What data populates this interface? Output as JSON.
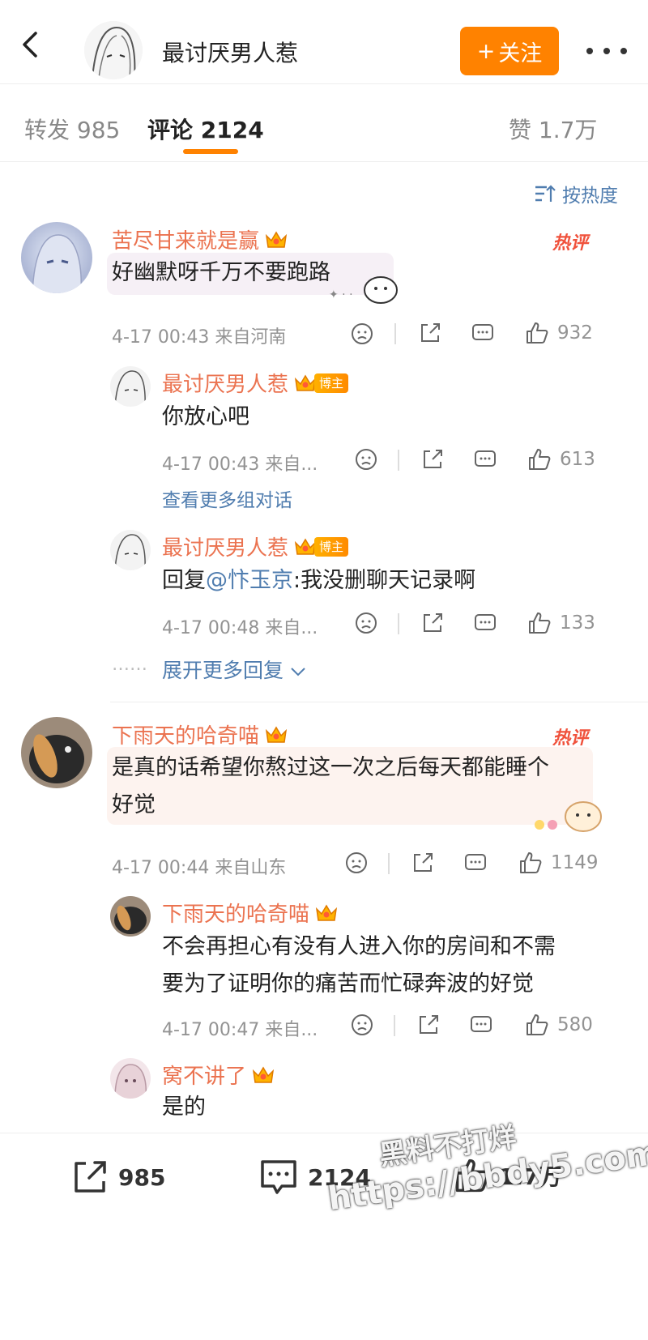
{
  "header": {
    "title": "最讨厌男人惹",
    "follow_label": "关注",
    "follow_plus": "+"
  },
  "tabs": {
    "repost": "转发 985",
    "comment": "评论 2124",
    "like": "赞 1.7万"
  },
  "sort_label": "按热度",
  "hot_label": "热评",
  "comments": [
    {
      "user": "苦尽甘来就是赢",
      "text": "好幽默呀千万不要跑路",
      "meta": "4-17 00:43  来自河南",
      "likes": "932",
      "replies": [
        {
          "user": "最讨厌男人惹",
          "badge": "博主",
          "text": "你放心吧",
          "meta": "4-17 00:43  来自...",
          "likes": "613"
        },
        {
          "user": "最讨厌男人惹",
          "badge": "博主",
          "text_prefix": "回复",
          "text_at": "@忭玉京",
          "text_rest": ":我没删聊天记录啊",
          "meta": "4-17 00:48  来自...",
          "likes": "133"
        }
      ],
      "view_more": "查看更多组对话",
      "expand_more": "展开更多回复",
      "expand_dots": "……"
    },
    {
      "user": "下雨天的哈奇喵",
      "text_line1": "是真的话希望你熬过这一次之后每天都能睡个",
      "text_line2": "好觉",
      "meta": "4-17 00:44  来自山东",
      "likes": "1149",
      "replies": [
        {
          "user": "下雨天的哈奇喵",
          "text_line1": "不会再担心有没有人进入你的房间和不需",
          "text_line2": "要为了证明你的痛苦而忙碌奔波的好觉",
          "meta": "4-17 00:47  来自...",
          "likes": "580"
        },
        {
          "user": "窝不讲了",
          "text": "是的"
        }
      ]
    }
  ],
  "bottom": {
    "repost": "985",
    "comment": "2124",
    "like": "1.7万"
  },
  "watermark": {
    "line1": "黑料不打烊",
    "line2": "https://bbdy5.com"
  },
  "colors": {
    "accent": "#ff8200",
    "username": "#eb7350",
    "link": "#507daf",
    "hot": "#f0523c"
  }
}
